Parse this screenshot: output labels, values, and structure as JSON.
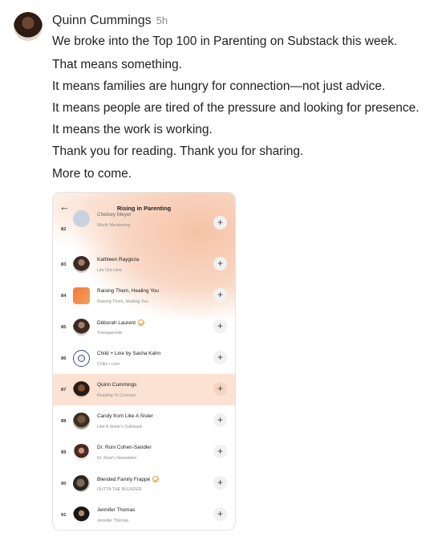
{
  "post": {
    "author": "Quinn Cummings",
    "time": "5h",
    "lines": [
      "We broke into the Top 100 in Parenting on Substack this week.",
      "That means something.",
      "It means families are hungry for connection—not just advice.",
      "It means people are tired of the pressure and looking for presence.",
      "It means the work is working.",
      "Thank you for reading. Thank you for sharing.",
      "More to come."
    ]
  },
  "screenshot": {
    "back_icon": "arrow-left-icon",
    "title": "Rising in Parenting",
    "rows": [
      {
        "rank": "82",
        "name": "Chelsey Meyer",
        "sub": "Worth Mentioning",
        "thumb": "t-top",
        "verified": false,
        "highlight": false
      },
      {
        "rank": "83",
        "name": "Kathleen Raygoza",
        "sub": "Life Out Here",
        "thumb": "t-dark",
        "verified": false,
        "highlight": false
      },
      {
        "rank": "84",
        "name": "Raising Them, Healing You",
        "sub": "Raising Them, Healing You",
        "thumb": "t-orange",
        "verified": false,
        "highlight": false
      },
      {
        "rank": "85",
        "name": "Déborah Laurent",
        "sub": "Transparente",
        "thumb": "t-dark",
        "verified": true,
        "highlight": false
      },
      {
        "rank": "86",
        "name": "Child + Line by Sasha Kahn",
        "sub": "Child + Line",
        "thumb": "t-logo",
        "verified": false,
        "highlight": false
      },
      {
        "rank": "87",
        "name": "Quinn Cummings",
        "sub": "Reading To Connect",
        "thumb": "t-quinn",
        "verified": false,
        "highlight": true
      },
      {
        "rank": "88",
        "name": "Candy from Like A Sister",
        "sub": "Like A Sister's Substack",
        "thumb": "t-candy",
        "verified": false,
        "highlight": false
      },
      {
        "rank": "89",
        "name": "Dr. Roni Cohen-Sandler",
        "sub": "Dr. Roni's Newsletter",
        "thumb": "t-roni",
        "verified": false,
        "highlight": false
      },
      {
        "rank": "90",
        "name": "Blended Family Frappé",
        "sub": "OUTTA THE BLENDER",
        "thumb": "t-blend",
        "verified": true,
        "highlight": false
      },
      {
        "rank": "91",
        "name": "Jennifer Thomas",
        "sub": "Jennifer Thomas",
        "thumb": "t-jen",
        "verified": false,
        "highlight": false
      }
    ],
    "plus_label": "+"
  }
}
